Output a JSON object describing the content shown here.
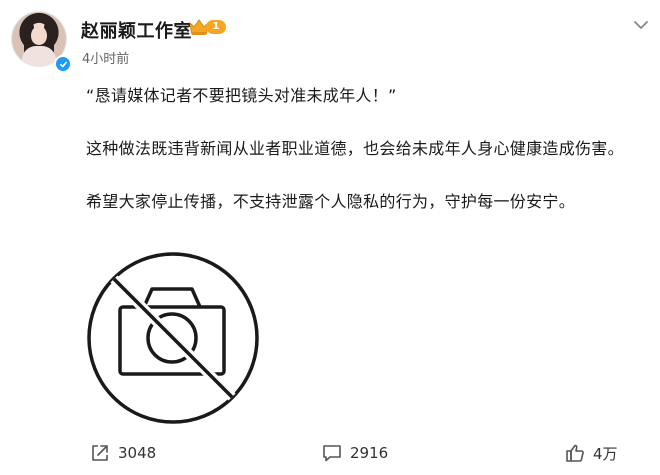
{
  "post": {
    "author": {
      "name": "赵丽颖工作室",
      "vip_level": "1",
      "avatar_icon": "avatar-photo",
      "verified_icon": "verified-check-icon",
      "vip_icon": "crown-icon"
    },
    "time": "4小时前",
    "menu_icon": "chevron-down-icon",
    "paragraphs": [
      "“恳请媒体记者不要把镜头对准未成年人！”",
      "这种做法既违背新闻从业者职业道德，也会给未成年人身心健康造成伤害。",
      "希望大家停止传播，不支持泄露个人隐私的行为，守护每一份安宁。"
    ],
    "image": {
      "icon": "no-camera-icon",
      "color": "#1a1a1a"
    }
  },
  "actions": {
    "forward": {
      "icon": "forward-icon",
      "count": "3048"
    },
    "comment": {
      "icon": "comment-icon",
      "count": "2916"
    },
    "like": {
      "icon": "thumbs-up-icon",
      "count": "4万"
    }
  },
  "colors": {
    "verified": "#1c9cf6",
    "vip": "#f5a623",
    "text": "#1a1a1a",
    "muted": "#666666"
  }
}
